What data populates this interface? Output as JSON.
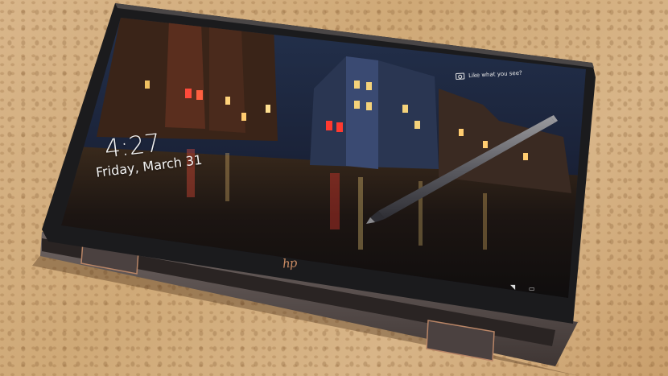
{
  "lock_screen": {
    "time": "4:27",
    "date": "Friday, March 31",
    "spotlight_text": "Like what you see?"
  },
  "device": {
    "brand_logo": "hp"
  },
  "icons": {
    "spotlight": "camera-icon",
    "network": "wifi-icon",
    "battery": "battery-icon"
  },
  "colors": {
    "cork": "#d2ad7e",
    "bezel": "#1b1b1d",
    "chassis": "#5a4f4d",
    "hinge_accent": "#b98566",
    "logo": "#c88a62"
  }
}
